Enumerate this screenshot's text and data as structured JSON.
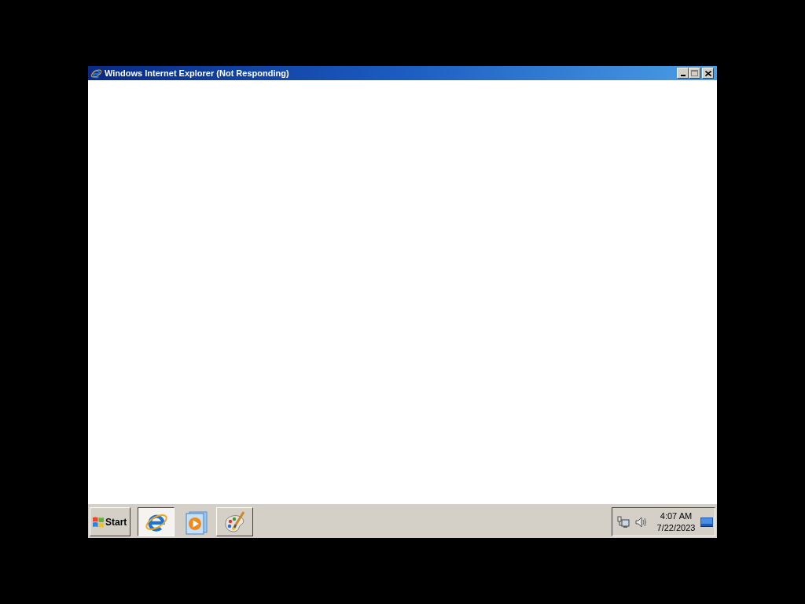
{
  "window": {
    "title": "Windows Internet Explorer (Not Responding)",
    "active": true
  },
  "taskbar": {
    "start_button": {
      "label": "Start"
    },
    "items": [
      {
        "kind": "task",
        "selected": true
      },
      {
        "kind": "launcher",
        "selected": false
      },
      {
        "kind": "task",
        "selected": false
      }
    ],
    "clock": {
      "time": "4:07 AM",
      "date": "7/22/2023"
    }
  }
}
